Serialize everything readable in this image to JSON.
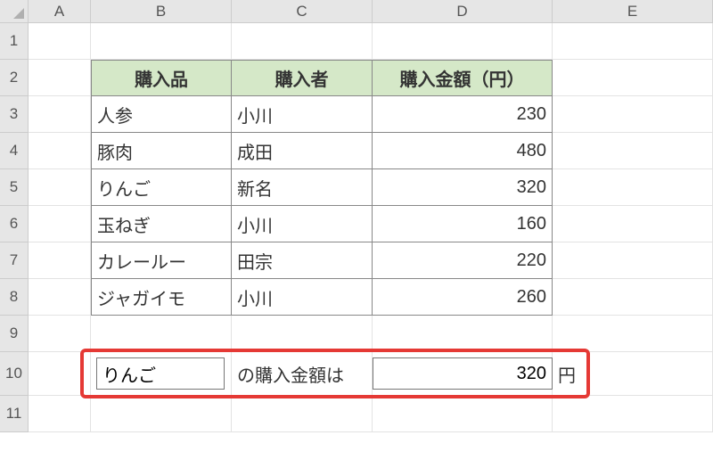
{
  "columns": [
    "A",
    "B",
    "C",
    "D",
    "E"
  ],
  "rows": [
    "1",
    "2",
    "3",
    "4",
    "5",
    "6",
    "7",
    "8",
    "9",
    "10",
    "11"
  ],
  "table": {
    "headers": {
      "B": "購入品",
      "C": "購入者",
      "D": "購入金額（円）"
    },
    "data": [
      {
        "B": "人参",
        "C": "小川",
        "D": "230"
      },
      {
        "B": "豚肉",
        "C": "成田",
        "D": "480"
      },
      {
        "B": "りんご",
        "C": "新名",
        "D": "320"
      },
      {
        "B": "玉ねぎ",
        "C": "小川",
        "D": "160"
      },
      {
        "B": "カレールー",
        "C": "田宗",
        "D": "220"
      },
      {
        "B": "ジャガイモ",
        "C": "小川",
        "D": "260"
      }
    ]
  },
  "lookup": {
    "item": "りんご",
    "label_mid": "の購入金額は",
    "result": "320",
    "label_end": "円"
  },
  "layout": {
    "colWidths": {
      "header": 32,
      "A": 70,
      "B": 158,
      "C": 158,
      "D": 202,
      "E": 180
    },
    "rowHeights": {
      "header": 26,
      "default": 41,
      "row10": 49
    }
  }
}
